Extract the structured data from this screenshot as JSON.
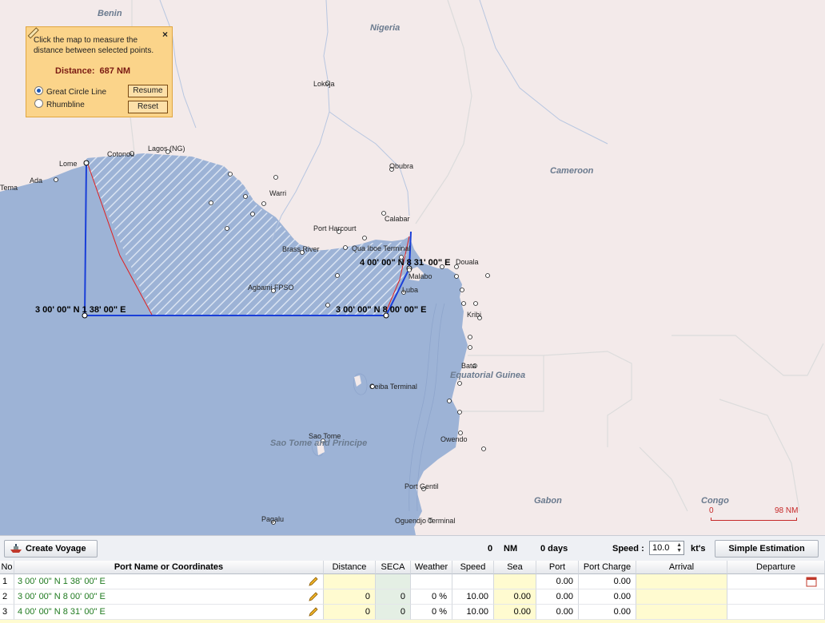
{
  "map": {
    "country_labels": [
      "Benin",
      "Nigeria",
      "Cameroon",
      "Equatorial Guinea",
      "Sao Tome and Principe",
      "Gabon",
      "Congo"
    ],
    "place_labels": [
      "Lome",
      "Cotonou",
      "Lagos (NG)",
      "Tema",
      "Ada",
      "Lokoja",
      "Warri",
      "Obubra",
      "Calabar",
      "Port Harcourt",
      "Brass River",
      "Qua Iboe Terminal",
      "Douala",
      "Malabo",
      "Luba",
      "Agbami FPSO",
      "Kribi",
      "Bata",
      "Ceiba Terminal",
      "Sao Tome",
      "Owendo",
      "Port Gentil",
      "Pagalu",
      "Oguendjo Terminal"
    ],
    "waypoint_labels": [
      "3 00' 00\" N  1 38' 00\" E",
      "3 00' 00\" N  8 00' 00\" E",
      "4 00' 00\" N  8 31' 00\" E"
    ],
    "colors": {
      "land": "#f3eaea",
      "sea": "#9db3d6",
      "route": "#1a3fd8",
      "great_circle": "#e02020",
      "border": "#e0e0e0"
    }
  },
  "measure_panel": {
    "hint": "Click the map to measure the distance between selected points.",
    "distance_label": "Distance:",
    "distance_value": "687 NM",
    "option_great_circle": "Great Circle Line",
    "option_rhumbline": "Rhumbline",
    "selected_option": "Great Circle Line",
    "resume_label": "Resume",
    "reset_label": "Reset",
    "close_symbol": "×"
  },
  "scale_bar": {
    "start": "0",
    "end": "98 NM"
  },
  "toolbar": {
    "create_voyage_label": "Create Voyage",
    "total_distance": "0",
    "distance_unit": "NM",
    "total_days": "0 days",
    "speed_label": "Speed :",
    "speed_value": "10.0",
    "speed_unit": "kt's",
    "simple_estimation_label": "Simple Estimation"
  },
  "table": {
    "columns": [
      "No",
      "Port Name or Coordinates",
      "Distance",
      "SECA",
      "Weather",
      "Speed",
      "Sea",
      "Port",
      "Port Charge",
      "Arrival",
      "Departure"
    ],
    "rows": [
      {
        "no": "1",
        "name": "3 00' 00\" N  1 38' 00\" E",
        "distance": "",
        "seca": "",
        "weather": "",
        "speed": "",
        "sea": "",
        "port": "0.00",
        "port_charge": "0.00",
        "arrival": "",
        "departure": ""
      },
      {
        "no": "2",
        "name": "3 00' 00\" N  8 00' 00\" E",
        "distance": "0",
        "seca": "0",
        "weather": "0 %",
        "speed": "10.00",
        "sea": "0.00",
        "port": "0.00",
        "port_charge": "0.00",
        "arrival": "",
        "departure": ""
      },
      {
        "no": "3",
        "name": "4 00' 00\" N  8 31' 00\" E",
        "distance": "0",
        "seca": "0",
        "weather": "0 %",
        "speed": "10.00",
        "sea": "0.00",
        "port": "0.00",
        "port_charge": "0.00",
        "arrival": "",
        "departure": ""
      }
    ]
  }
}
